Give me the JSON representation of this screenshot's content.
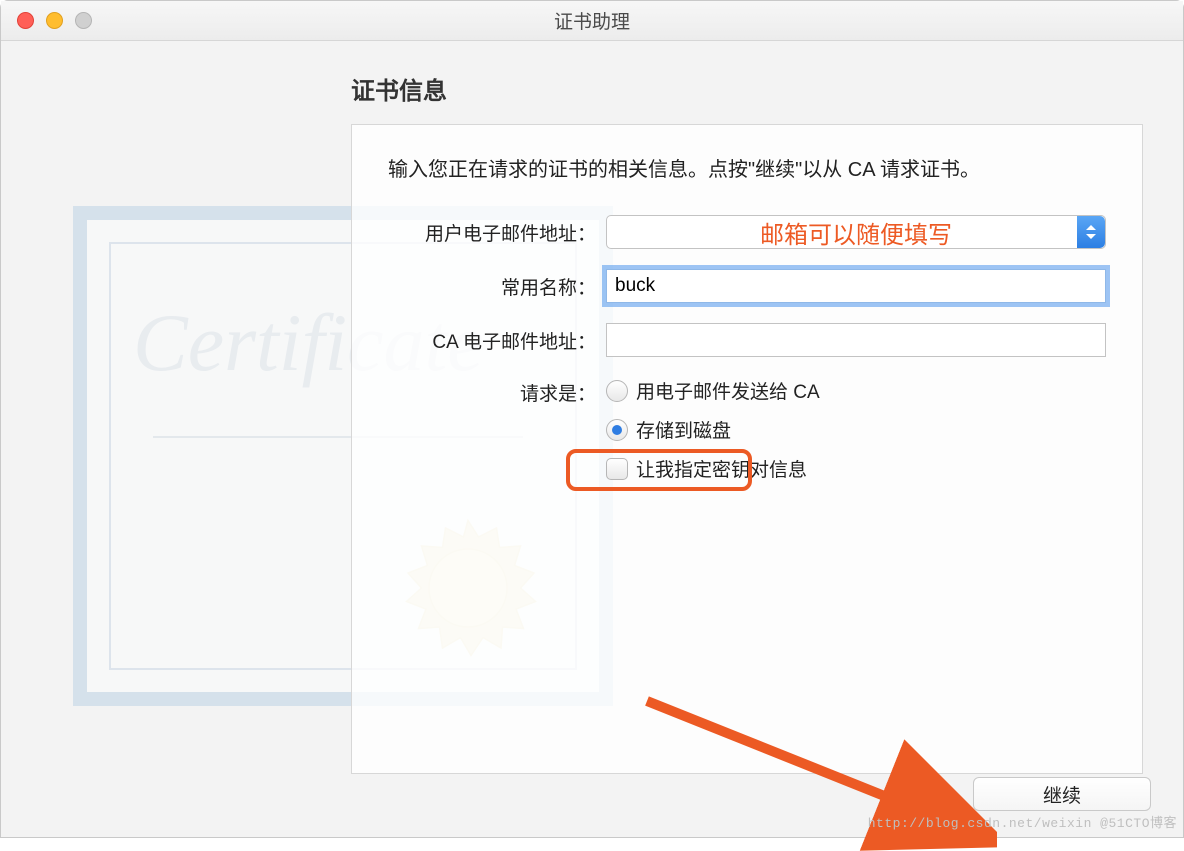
{
  "window": {
    "title": "证书助理"
  },
  "page": {
    "heading": "证书信息",
    "intro": "输入您正在请求的证书的相关信息。点按\"继续\"以从 CA 请求证书。"
  },
  "form": {
    "email_label": "用户电子邮件地址：",
    "email_value": "",
    "common_name_label": "常用名称：",
    "common_name_value": "buck",
    "ca_email_label": "CA 电子邮件地址：",
    "ca_email_value": "",
    "request_label": "请求是：",
    "radio_email_ca": "用电子邮件发送给 CA",
    "radio_save_disk": "存储到磁盘",
    "checkbox_keypair": "让我指定密钥对信息"
  },
  "annotation": {
    "email_hint": "邮箱可以随便填写"
  },
  "buttons": {
    "continue": "继续"
  },
  "background": {
    "script_text": "Certificate"
  },
  "watermark": "http://blog.csdn.net/weixin @51CTO博客"
}
